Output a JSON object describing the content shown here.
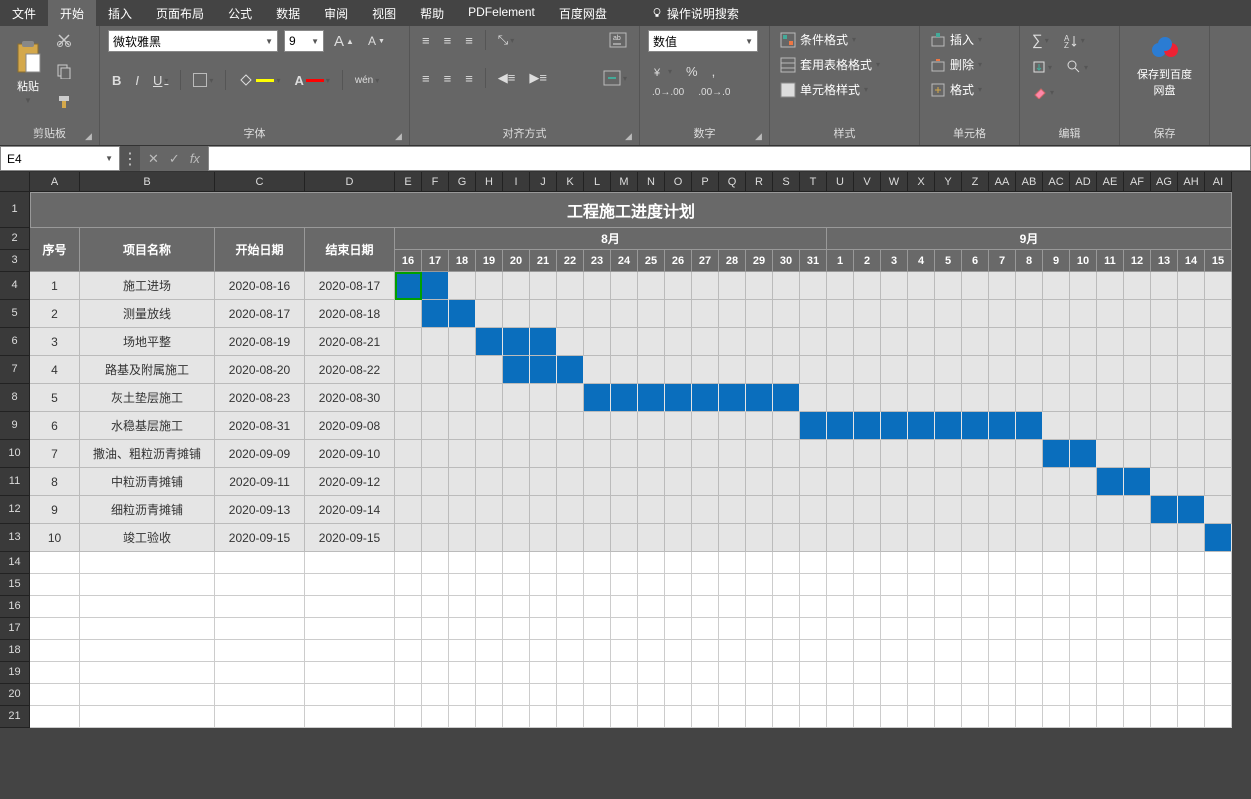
{
  "tabs": {
    "file": "文件",
    "home": "开始",
    "insert": "插入",
    "layout": "页面布局",
    "formula": "公式",
    "data": "数据",
    "review": "审阅",
    "view": "视图",
    "help": "帮助",
    "pdf": "PDFelement",
    "baidu": "百度网盘",
    "tellme": "操作说明搜索"
  },
  "ribbon": {
    "clipboard": {
      "paste": "粘贴",
      "label": "剪贴板"
    },
    "font": {
      "name": "微软雅黑",
      "size": "9",
      "bold": "B",
      "italic": "I",
      "underline": "U",
      "wen": "wén",
      "label": "字体"
    },
    "align": {
      "label": "对齐方式"
    },
    "number": {
      "format": "数值",
      "label": "数字"
    },
    "styles": {
      "cond": "条件格式",
      "table": "套用表格格式",
      "cell": "单元格样式",
      "label": "样式"
    },
    "cells": {
      "insert": "插入",
      "delete": "删除",
      "format": "格式",
      "label": "单元格"
    },
    "editing": {
      "label": "编辑"
    },
    "save": {
      "btn": "保存到百度网盘",
      "label": "保存"
    }
  },
  "fbar": {
    "namebox": "E4",
    "fx": "fx"
  },
  "sheet": {
    "title": "工程施工进度计划",
    "headers": {
      "seq": "序号",
      "name": "项目名称",
      "start": "开始日期",
      "end": "结束日期",
      "m8": "8月",
      "m9": "9月"
    },
    "days8": [
      "16",
      "17",
      "18",
      "19",
      "20",
      "21",
      "22",
      "23",
      "24",
      "25",
      "26",
      "27",
      "28",
      "29",
      "30",
      "31"
    ],
    "days9": [
      "1",
      "2",
      "3",
      "4",
      "5",
      "6",
      "7",
      "8",
      "9",
      "10",
      "11",
      "12",
      "13",
      "14",
      "15"
    ],
    "cols": [
      "A",
      "B",
      "C",
      "D",
      "E",
      "F",
      "G",
      "H",
      "I",
      "J",
      "K",
      "L",
      "M",
      "N",
      "O",
      "P",
      "Q",
      "R",
      "S",
      "T",
      "U",
      "V",
      "W",
      "X",
      "Y",
      "Z",
      "AA",
      "AB",
      "AC",
      "AD",
      "AE",
      "AF",
      "AG",
      "AH",
      "AI"
    ],
    "rows": [
      {
        "seq": "1",
        "name": "施工进场",
        "start": "2020-08-16",
        "end": "2020-08-17",
        "f": 0,
        "t": 1
      },
      {
        "seq": "2",
        "name": "测量放线",
        "start": "2020-08-17",
        "end": "2020-08-18",
        "f": 1,
        "t": 2
      },
      {
        "seq": "3",
        "name": "场地平整",
        "start": "2020-08-19",
        "end": "2020-08-21",
        "f": 3,
        "t": 5
      },
      {
        "seq": "4",
        "name": "路基及附属施工",
        "start": "2020-08-20",
        "end": "2020-08-22",
        "f": 4,
        "t": 6
      },
      {
        "seq": "5",
        "name": "灰土垫层施工",
        "start": "2020-08-23",
        "end": "2020-08-30",
        "f": 7,
        "t": 14
      },
      {
        "seq": "6",
        "name": "水稳基层施工",
        "start": "2020-08-31",
        "end": "2020-09-08",
        "f": 15,
        "t": 23
      },
      {
        "seq": "7",
        "name": "撒油、粗粒沥青摊铺",
        "start": "2020-09-09",
        "end": "2020-09-10",
        "f": 24,
        "t": 25
      },
      {
        "seq": "8",
        "name": "中粒沥青摊铺",
        "start": "2020-09-11",
        "end": "2020-09-12",
        "f": 26,
        "t": 27
      },
      {
        "seq": "9",
        "name": "细粒沥青摊铺",
        "start": "2020-09-13",
        "end": "2020-09-14",
        "f": 28,
        "t": 29
      },
      {
        "seq": "10",
        "name": "竣工验收",
        "start": "2020-09-15",
        "end": "2020-09-15",
        "f": 30,
        "t": 30
      }
    ]
  },
  "chart_data": {
    "type": "table",
    "title": "工程施工进度计划",
    "columns": [
      "序号",
      "项目名称",
      "开始日期",
      "结束日期"
    ],
    "gantt_range": {
      "start": "2020-08-16",
      "end": "2020-09-15"
    },
    "rows": [
      [
        "1",
        "施工进场",
        "2020-08-16",
        "2020-08-17"
      ],
      [
        "2",
        "测量放线",
        "2020-08-17",
        "2020-08-18"
      ],
      [
        "3",
        "场地平整",
        "2020-08-19",
        "2020-08-21"
      ],
      [
        "4",
        "路基及附属施工",
        "2020-08-20",
        "2020-08-22"
      ],
      [
        "5",
        "灰土垫层施工",
        "2020-08-23",
        "2020-08-30"
      ],
      [
        "6",
        "水稳基层施工",
        "2020-08-31",
        "2020-09-08"
      ],
      [
        "7",
        "撒油、粗粒沥青摊铺",
        "2020-09-09",
        "2020-09-10"
      ],
      [
        "8",
        "中粒沥青摊铺",
        "2020-09-11",
        "2020-09-12"
      ],
      [
        "9",
        "细粒沥青摊铺",
        "2020-09-13",
        "2020-09-14"
      ],
      [
        "10",
        "竣工验收",
        "2020-09-15",
        "2020-09-15"
      ]
    ]
  }
}
